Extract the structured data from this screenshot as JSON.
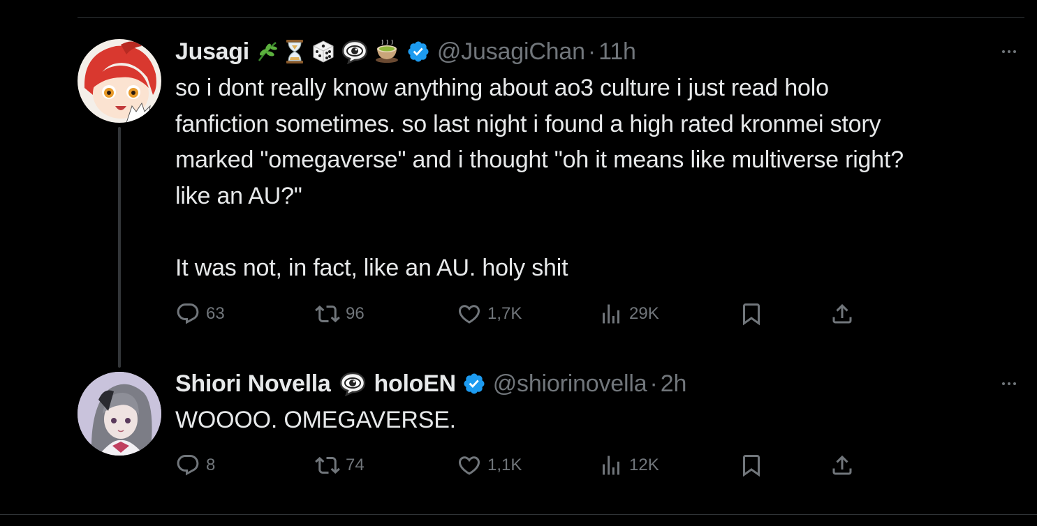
{
  "tweets": [
    {
      "name": "Jusagi",
      "emojis": [
        "🌿",
        "⏳",
        "🎲",
        "👁‍🗨",
        "🍵"
      ],
      "handle": "@JusagiChan",
      "separator": "·",
      "time": "11h",
      "text": "so i dont really know anything about ao3 culture i just read holo\nfanfiction sometimes. so last night i found a high rated kronmei story\nmarked \"omegaverse\" and i thought \"oh it means like multiverse right?\nlike an AU?\"\n\nIt was not, in fact, like an AU. holy shit",
      "stats": {
        "replies": "63",
        "reposts": "96",
        "likes": "1,7K",
        "views": "29K"
      },
      "avatar_colors": {
        "hair": "#d9382f",
        "skin": "#fbe3d1",
        "bg": "#ffffff"
      }
    },
    {
      "name": "Shiori Novella",
      "name_emoji": "👁‍🗨",
      "name_suffix": "holoEN",
      "handle": "@shiorinovella",
      "separator": "·",
      "time": "2h",
      "text": "WOOOO. OMEGAVERSE.",
      "stats": {
        "replies": "8",
        "reposts": "74",
        "likes": "1,1K",
        "views": "12K"
      },
      "avatar_colors": {
        "hair": "#8a8a92",
        "skin": "#efe3e1",
        "bg": "#c9c3dc"
      }
    }
  ],
  "colors": {
    "background": "#000000",
    "text": "#e7e9ea",
    "muted": "#71767b",
    "verified": "#1d9bf0",
    "divider": "#2f3336"
  }
}
